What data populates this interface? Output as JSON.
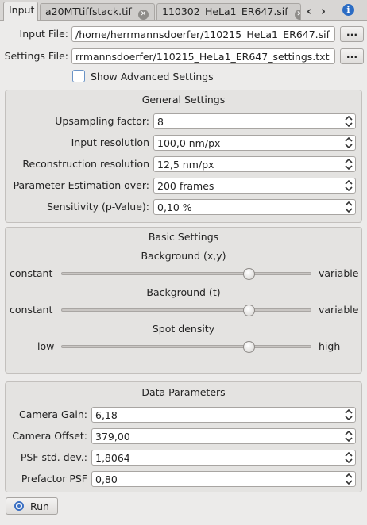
{
  "tabs": [
    {
      "label": "Input"
    },
    {
      "label": "a20MTtiffstack.tif"
    },
    {
      "label": "110302_HeLa1_ER647.sif"
    }
  ],
  "tab_nav": {
    "prev": "‹",
    "next": "›",
    "info": "i",
    "close": "✕"
  },
  "input": {
    "input_file_label": "Input File:",
    "input_file_value": "/home/herrmannsdoerfer/110215_HeLa1_ER647.sif",
    "settings_file_label": "Settings File:",
    "settings_file_value": "rrmannsdoerfer/110215_HeLa1_ER647_settings.txt",
    "browse_label": "...",
    "advanced_label": "Show Advanced Settings",
    "advanced_checked": false
  },
  "general": {
    "title": "General Settings",
    "fields": [
      {
        "label": "Upsampling factor:",
        "value": "8"
      },
      {
        "label": "Input resolution",
        "value": "100,0 nm/px"
      },
      {
        "label": "Reconstruction resolution",
        "value": "12,5 nm/px"
      },
      {
        "label": "Parameter Estimation over:",
        "value": "200 frames"
      },
      {
        "label": "Sensitivity (p-Value):",
        "value": "0,10 %"
      }
    ]
  },
  "basic": {
    "title": "Basic Settings",
    "sliders": [
      {
        "title": "Background (x,y)",
        "left": "constant",
        "right": "variable",
        "position": 0.75
      },
      {
        "title": "Background (t)",
        "left": "constant",
        "right": "variable",
        "position": 0.75
      },
      {
        "title": "Spot density",
        "left": "low",
        "right": "high",
        "position": 0.75
      }
    ]
  },
  "data": {
    "title": "Data Parameters",
    "fields": [
      {
        "label": "Camera Gain:",
        "value": "6,18"
      },
      {
        "label": "Camera Offset:",
        "value": "379,00"
      },
      {
        "label": "PSF std. dev.:",
        "value": "1,8064"
      },
      {
        "label": "Prefactor PSF",
        "value": "0,80"
      }
    ]
  },
  "run_label": "Run",
  "colors": {
    "accent": "#3a6fc2",
    "info": "#2b6cc4",
    "panel": "#ecebea"
  }
}
